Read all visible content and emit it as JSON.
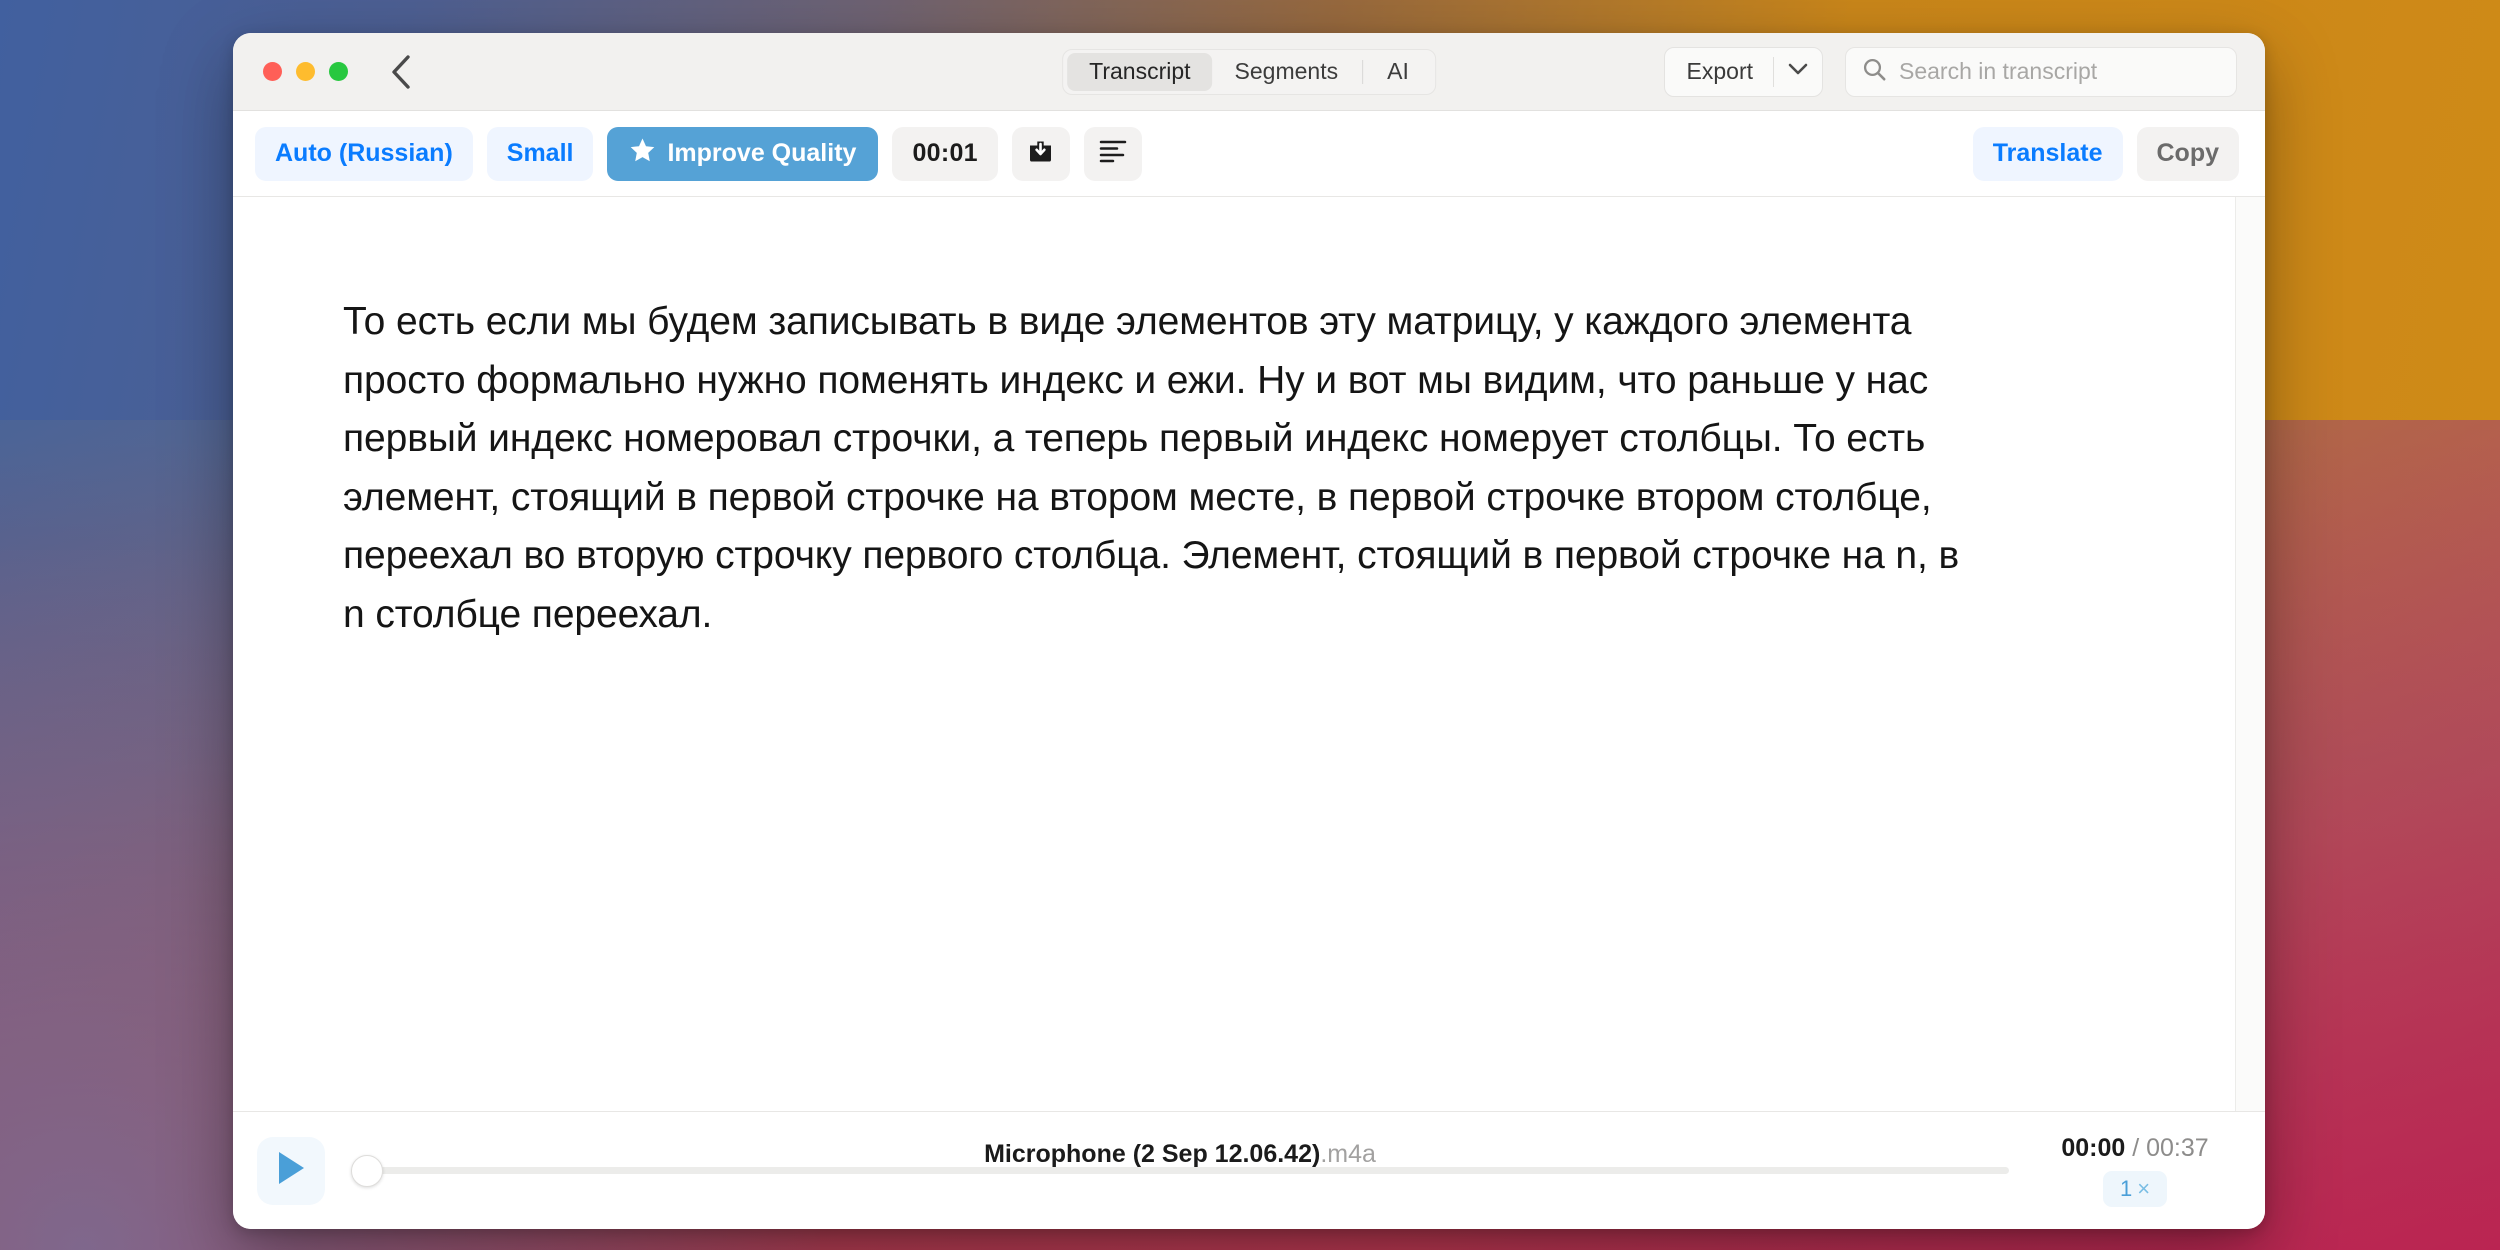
{
  "window": {
    "traffic_lights": [
      "close",
      "minimize",
      "maximize"
    ],
    "back_icon": "chevron-left-icon"
  },
  "titlebar": {
    "tabs": [
      {
        "label": "Transcript",
        "active": true
      },
      {
        "label": "Segments",
        "active": false
      },
      {
        "label": "AI",
        "active": false
      }
    ],
    "export": {
      "label": "Export",
      "caret_icon": "chevron-down-icon"
    },
    "search": {
      "placeholder": "Search in transcript",
      "value": "",
      "icon": "search-icon"
    }
  },
  "toolbar": {
    "language": "Auto (Russian)",
    "model": "Small",
    "improve": {
      "label": "Improve Quality",
      "icon": "star-icon"
    },
    "elapsed": "00:01",
    "save_icon": "download-to-box-icon",
    "format_icon": "text-align-left-icon",
    "translate": "Translate",
    "copy": "Copy"
  },
  "transcript": {
    "text": "То есть если мы будем записывать в виде элементов эту матрицу, у каждого элемента просто формально нужно поменять индекс и ежи. Ну и вот мы видим, что раньше у нас первый индекс номеровал строчки, а теперь первый индекс номерует столбцы. То есть элемент, стоящий в первой строчке на втором месте, в первой строчке втором столбце, переехал во вторую строчку первого столбца. Элемент, стоящий в первой строчке на n, в n столбце переехал."
  },
  "player": {
    "play_icon": "play-icon",
    "track_name": "Microphone (2 Sep 12.06.42)",
    "track_ext": ".m4a",
    "current_time": "00:00",
    "time_separator": "/",
    "total_time": "00:37",
    "speed": "1",
    "speed_unit": "×",
    "progress_percent": 0
  },
  "colors": {
    "accent_blue": "#0a7cff",
    "improve_blue": "#55a2d6",
    "play_blue": "#4a9fd8",
    "traffic_red": "#ff5f57",
    "traffic_yellow": "#febc2e",
    "traffic_green": "#28c840"
  }
}
